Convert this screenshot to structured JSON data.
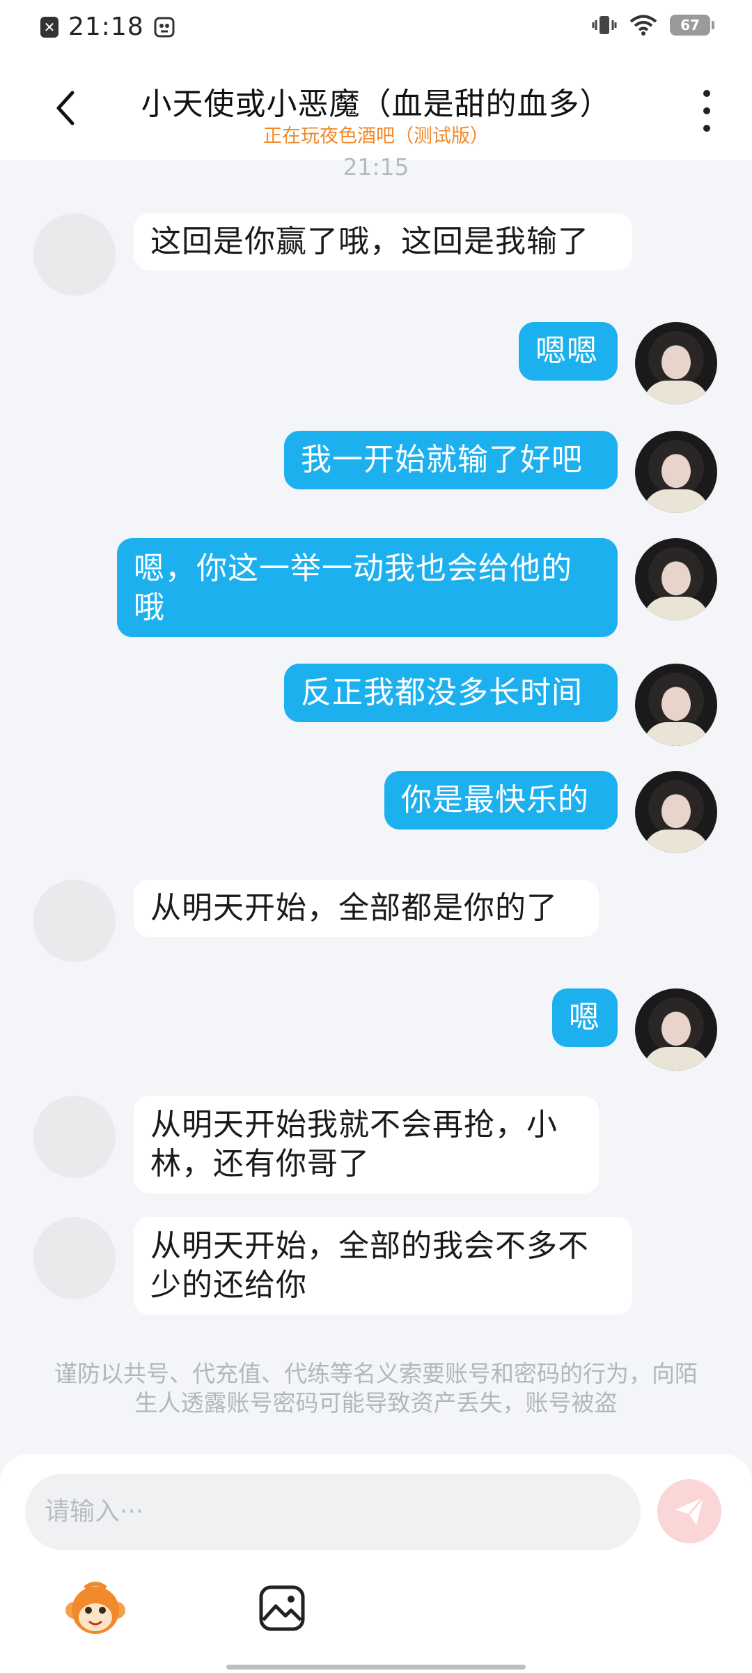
{
  "status_bar": {
    "time": "21:18",
    "battery": "67"
  },
  "header": {
    "title": "小天使或小恶魔（血是甜的血多）",
    "subtitle": "正在玩夜色酒吧（测试版）"
  },
  "chat": {
    "timestamp": "21:15",
    "messages": [
      {
        "side": "in",
        "text": "这回是你赢了哦，这回是我输了"
      },
      {
        "side": "out",
        "text": "嗯嗯"
      },
      {
        "side": "out",
        "text": "我一开始就输了好吧"
      },
      {
        "side": "out",
        "text": "嗯，你这一举一动我也会给他的哦"
      },
      {
        "side": "out",
        "text": "反正我都没多长时间"
      },
      {
        "side": "out",
        "text": "你是最快乐的"
      },
      {
        "side": "in",
        "text": "从明天开始，全部都是你的了"
      },
      {
        "side": "out",
        "text": "嗯"
      },
      {
        "side": "in",
        "text": "从明天开始我就不会再抢，小林，还有你哥了"
      },
      {
        "side": "in",
        "text": "从明天开始，全部的我会不多不少的还给你"
      }
    ]
  },
  "notice": "谨防以共号、代充值、代练等名义索要账号和密码的行为，向陌生人透露账号密码可能导致资产丢失，账号被盗",
  "input": {
    "placeholder": "请输入···"
  },
  "colors": {
    "outgoing_bubble": "#1db0ef",
    "incoming_bubble": "#ffffff",
    "subtitle": "#f0892a",
    "send_button": "#fbd6d6"
  }
}
